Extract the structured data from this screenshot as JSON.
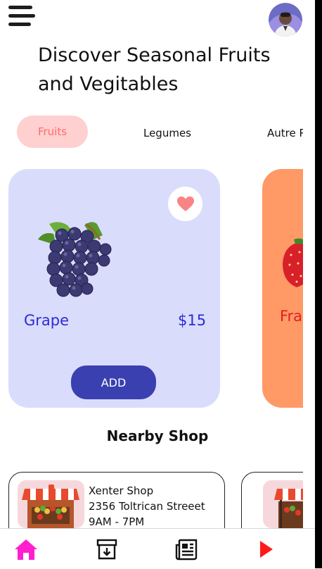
{
  "header": {
    "menu_icon": "hamburger-menu-icon",
    "avatar_alt": "profile-avatar",
    "title": "Discover Seasonal Fruits and Vegitables"
  },
  "tabs": [
    {
      "label": "Fruits",
      "active": true
    },
    {
      "label": "Legumes",
      "active": false
    },
    {
      "label": "Autre Produits",
      "active": false
    }
  ],
  "products": [
    {
      "name": "Grape",
      "price": "$15",
      "button_label": "ADD",
      "favorite": true,
      "image_icon": "grape-image",
      "card_color": "#dadcfc"
    },
    {
      "name": "Fraise",
      "image_icon": "strawberry-image",
      "card_color": "#ff9966"
    }
  ],
  "nearby": {
    "title": "Nearby Shop",
    "shops": [
      {
        "name": "Xenter Shop",
        "address": "2356 Toltrican Streeet",
        "hours": "9AM - 7PM",
        "image_icon": "market-stall-image"
      },
      {
        "image_icon": "market-stall-image"
      }
    ]
  },
  "bottom_nav": [
    {
      "icon": "home-icon",
      "color": "#ff1fd0",
      "active": true
    },
    {
      "icon": "archive-download-icon",
      "color": "#111111"
    },
    {
      "icon": "newspaper-icon",
      "color": "#111111"
    },
    {
      "icon": "play-icon",
      "color": "#ff1a1a"
    }
  ],
  "colors": {
    "accent_pink": "#ff6b6b",
    "tab_active_bg": "#ffd0d0",
    "grape_card_bg": "#dadcfc",
    "price_text": "#2b2bd6",
    "add_button": "#3a40b0",
    "strawberry_card_bg": "#ff9966",
    "strawberry_text": "#e02020"
  }
}
